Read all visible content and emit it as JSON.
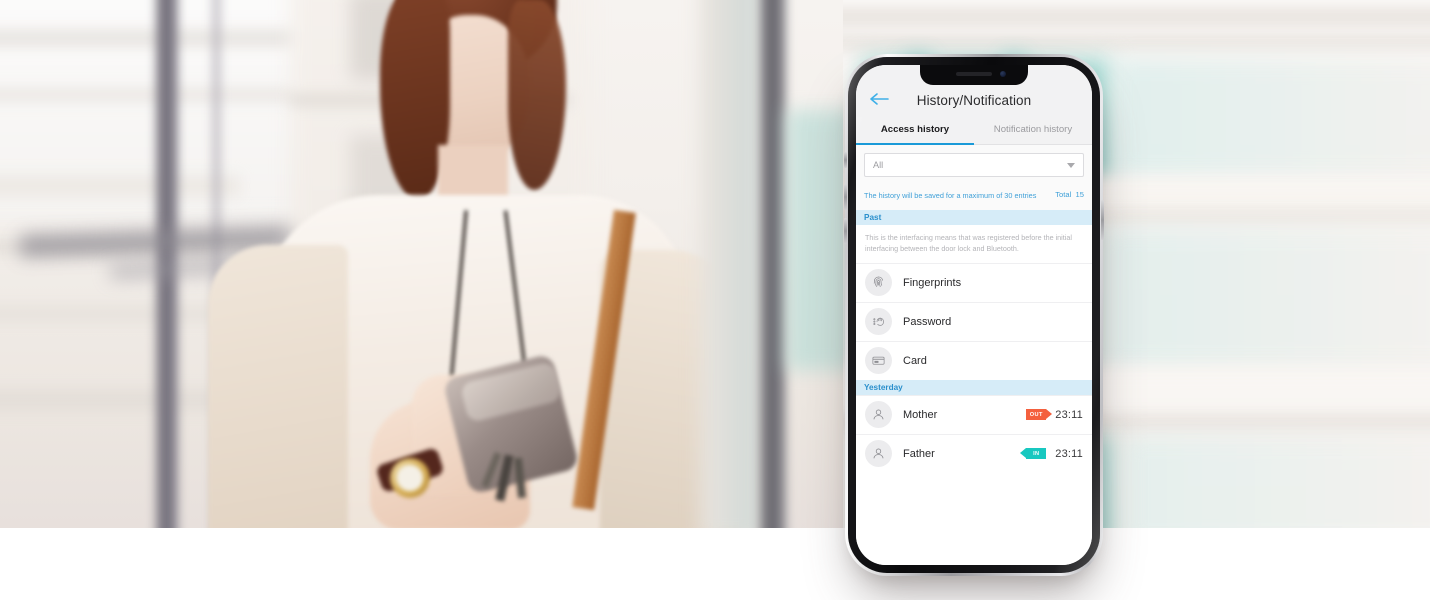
{
  "scene": {
    "description": "Woman by a window using a smartphone; blurred city window background",
    "background_colors": {
      "photo_wash": "#f3efeb",
      "right_backdrop": "#f8f5f2",
      "shutter_teal": "#9ad9d4",
      "bottom_band": "#ffffff"
    }
  },
  "phone": {
    "frame_color": "#0c0c0e",
    "rim_color": "#c9c9cc",
    "screen_bg": "#f7f7f8"
  },
  "app": {
    "header": {
      "title": "History/Notification",
      "back_icon": "arrow-left-icon",
      "back_icon_color": "#3fb0e8",
      "bg": "#f2f2f3"
    },
    "tabs": [
      {
        "label": "Access history",
        "active": true
      },
      {
        "label": "Notification history",
        "active": false
      }
    ],
    "tab_accent": "#1a9ad8",
    "filter": {
      "value": "All",
      "placeholder": "All",
      "caret_icon": "chevron-down-icon"
    },
    "info": {
      "text": "The history will be saved for a maximum of 30 entries",
      "total_label": "Total",
      "total_value": "15",
      "color": "#3fa0d8"
    },
    "sections": [
      {
        "title": "Past",
        "description": "This is the interfacing means that was registered before the initial interfacing between the door lock and Bluetooth.",
        "rows": [
          {
            "icon": "fingerprint-icon",
            "label": "Fingerprints",
            "badge": "",
            "time": ""
          },
          {
            "icon": "keypad-hand-icon",
            "label": "Password",
            "badge": "",
            "time": ""
          },
          {
            "icon": "card-icon",
            "label": "Card",
            "badge": "",
            "time": ""
          }
        ]
      },
      {
        "title": "Yesterday",
        "description": "",
        "rows": [
          {
            "icon": "person-icon",
            "label": "Mother",
            "badge": "OUT",
            "badge_color": "#f4603e",
            "time": "23:11"
          },
          {
            "icon": "person-icon",
            "label": "Father",
            "badge": "IN",
            "badge_color": "#18c8c0",
            "time": "23:11"
          }
        ]
      }
    ],
    "section_header_bg": "#d6ecf8",
    "section_header_color": "#2a8fcc"
  }
}
